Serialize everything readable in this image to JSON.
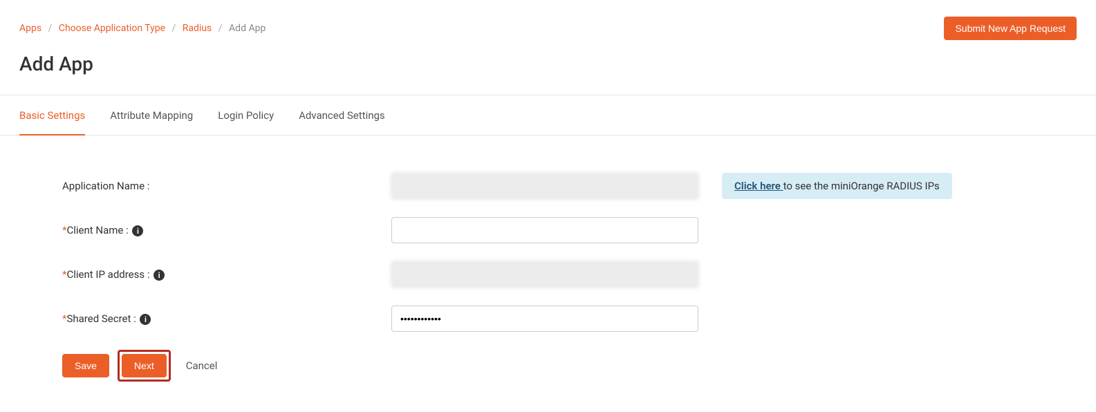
{
  "breadcrumb": {
    "apps": "Apps",
    "choose_type": "Choose Application Type",
    "radius": "Radius",
    "current": "Add App"
  },
  "header": {
    "submit_btn": "Submit New App Request",
    "page_title": "Add App"
  },
  "tabs": {
    "basic": "Basic Settings",
    "attr": "Attribute Mapping",
    "login": "Login Policy",
    "advanced": "Advanced Settings"
  },
  "form": {
    "app_name_label": "Application Name :",
    "app_name_value": "",
    "client_name_label": "Client Name :",
    "client_name_value": "",
    "client_ip_label": "Client IP address :",
    "client_ip_value": "",
    "shared_secret_label": "Shared Secret :",
    "shared_secret_value": "••••••••••••",
    "info_link": "Click here ",
    "info_text": "to see the miniOrange RADIUS IPs"
  },
  "buttons": {
    "save": "Save",
    "next": "Next",
    "cancel": "Cancel"
  }
}
